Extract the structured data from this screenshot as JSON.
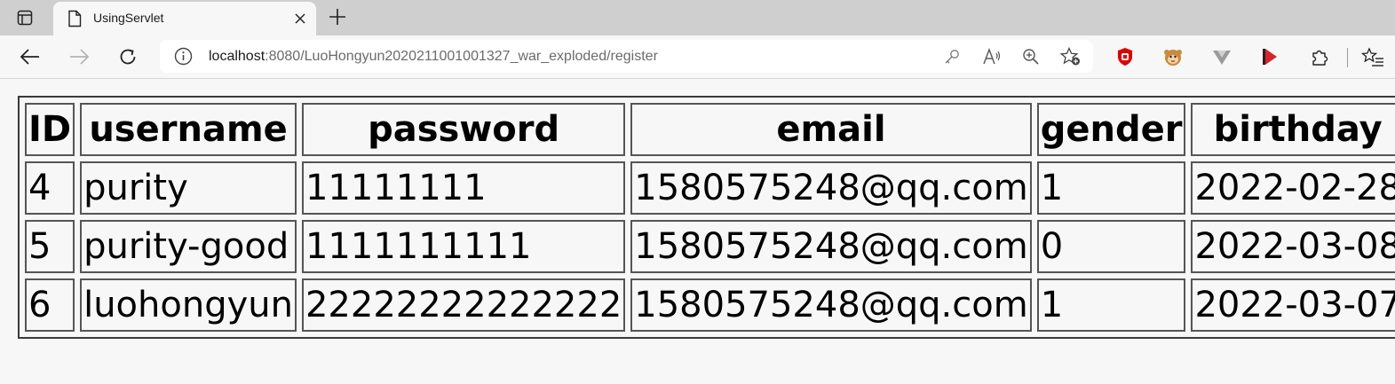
{
  "browser": {
    "tab": {
      "title": "UsingServlet"
    },
    "address": {
      "host": "localhost",
      "path": ":8080/LuoHongyun2020211001001327_war_exploded/register"
    }
  },
  "table": {
    "headers": [
      "ID",
      "username",
      "password",
      "email",
      "gender",
      "birthday"
    ],
    "rows": [
      [
        "4",
        "purity",
        "11111111",
        "1580575248@qq.com",
        "1",
        "2022-02-28"
      ],
      [
        "5",
        "purity-good",
        "1111111111",
        "1580575248@qq.com",
        "0",
        "2022-03-08"
      ],
      [
        "6",
        "luohongyun",
        "22222222222222",
        "1580575248@qq.com",
        "1",
        "2022-03-07"
      ]
    ]
  }
}
